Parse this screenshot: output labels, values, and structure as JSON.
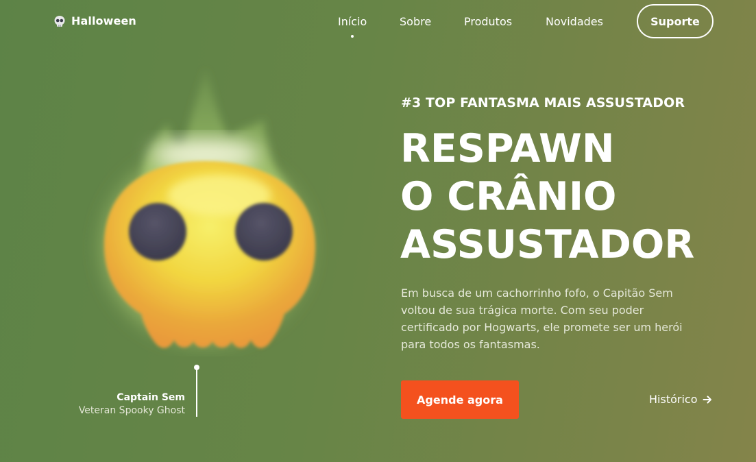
{
  "brand": {
    "name": "Halloween",
    "icon": "skull-icon"
  },
  "nav": {
    "items": [
      {
        "label": "Início",
        "active": true
      },
      {
        "label": "Sobre",
        "active": false
      },
      {
        "label": "Produtos",
        "active": false
      },
      {
        "label": "Novidades",
        "active": false
      }
    ],
    "support_label": "Suporte"
  },
  "hero": {
    "eyebrow": "#3 TOP FANTASMA MAIS ASSUSTADOR",
    "headline": [
      "RESPAWN",
      "O CRÂNIO",
      "ASSUSTADOR"
    ],
    "description": "Em busca de um cachorrinho fofo, o Capitão Sem voltou de sua trágica morte. Com seu poder certificado por Hogwarts, ele promete ser um herói para todos os fantasmas.",
    "cta_label": "Agende agora",
    "secondary_label": "Histórico",
    "secondary_icon": "arrow-right-icon"
  },
  "character": {
    "name": "Captain Sem",
    "role": "Veteran Spooky Ghost"
  },
  "colors": {
    "background_start": "#5d8347",
    "background_end": "#84844a",
    "accent": "#f4511e",
    "skull_yellow": "#f4e64a",
    "skull_orange": "#e9a23a",
    "eyes": "#464459",
    "flame_green": "#a4c86a"
  }
}
